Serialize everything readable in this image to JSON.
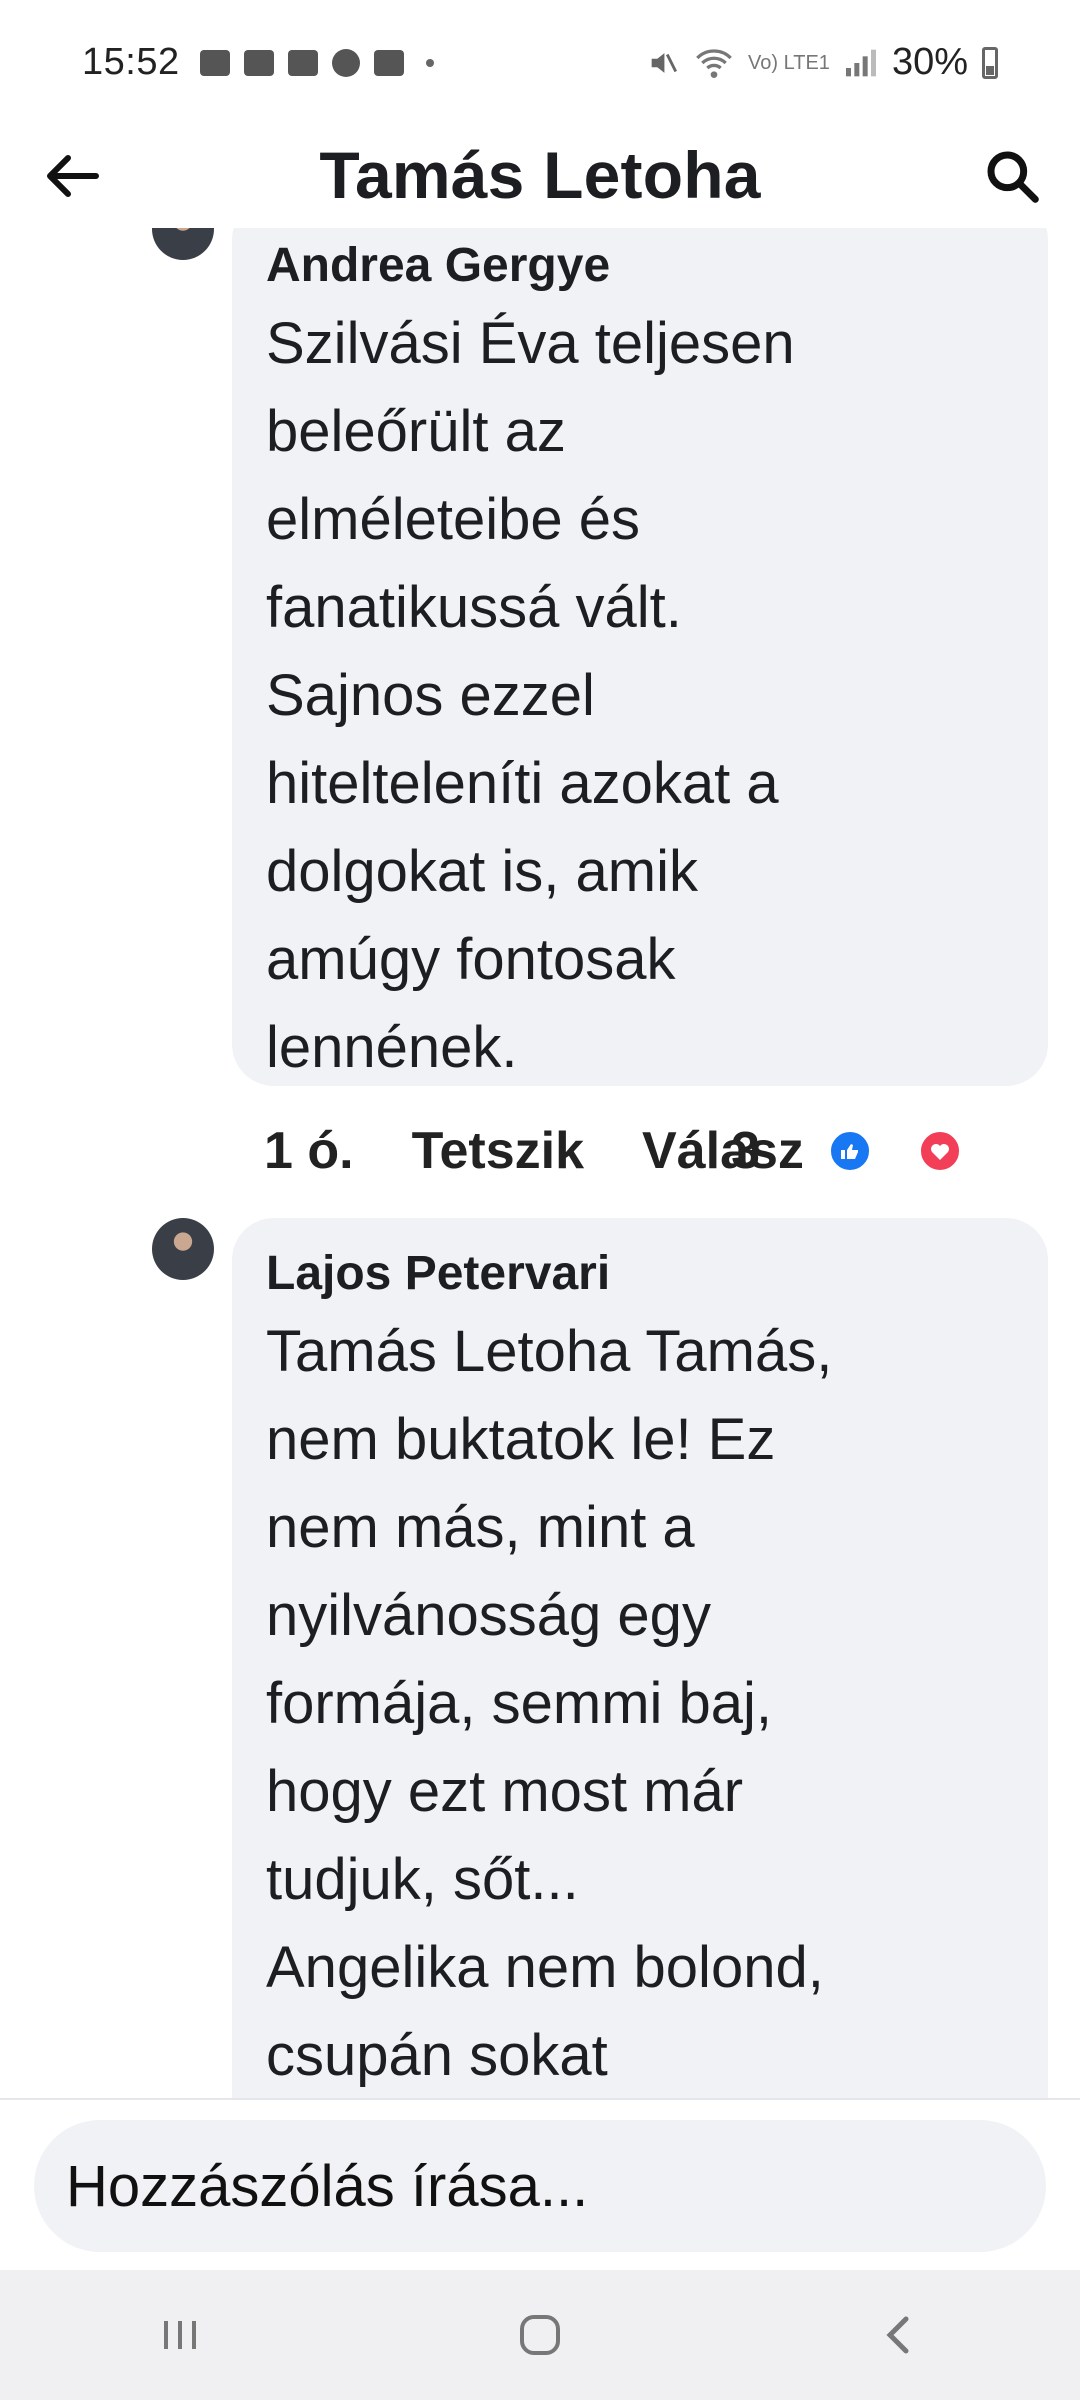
{
  "status": {
    "time": "15:52",
    "battery": "30%",
    "network": "Vo) LTE1"
  },
  "header": {
    "title": "Tamás Letoha"
  },
  "comments": [
    {
      "author": "Andrea Gergye",
      "text": "Szilvási Éva teljesen\nbeleőrült az\nelméleteibe és\nfanatikussá vált.\nSajnos ezzel\nhiteltelеníti azokat a\ndolgokat is, amik\namúgy fontosak\nlennének.",
      "time": "1 ó.",
      "like_label": "Tetszik",
      "reply_label": "Válasz",
      "reaction_count": "3"
    },
    {
      "author": "Lajos Petervari",
      "text": "Tamás Letoha Tamás,\nnem buktatok le! Ez\nnem más, mint a\nnyilvánosság egy\nformája, semmi baj,\nhogy ezt most már\ntudjuk, sőt...\nAngelika nem bolond,\ncsupán sokat"
    }
  ],
  "composer": {
    "placeholder": "Hozzászólás írása..."
  },
  "colors": {
    "bubble": "#f0f2f5",
    "like": "#1877f2",
    "love": "#f33e58"
  }
}
